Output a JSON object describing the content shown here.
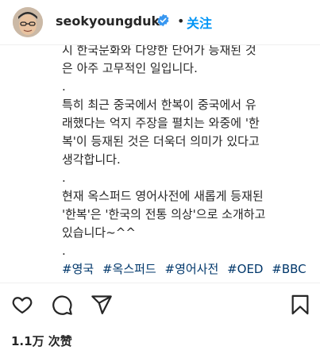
{
  "header": {
    "username": "seokyoungduk",
    "separator": "•",
    "follow_label": "关注"
  },
  "caption": {
    "lines": [
      "시 한국문화와 다양한 단어가 등재된 것",
      "은 아주 고무적인 일입니다.",
      ".",
      "특히 최근 중국에서 한복이 중국에서 유",
      "래했다는 억지 주장을 펼치는 와중에 '한",
      "복'이 등재된 것은 더욱더 의미가 있다고",
      "생각합니다.",
      ".",
      "현재 옥스퍼드 영어사전에 새롭게 등재된",
      "'한복'은 '한국의 전통 의상'으로 소개하고",
      "있습니다~^^",
      "."
    ],
    "hashtags": [
      "#영국",
      "#옥스퍼드",
      "#영어사전",
      "#OED",
      "#BBC"
    ]
  },
  "actions": {
    "icons": [
      "heart-icon",
      "comment-icon",
      "share-icon",
      "bookmark-icon"
    ]
  },
  "likes": {
    "text": "1.1万 次赞"
  },
  "colors": {
    "follow": "#0095f6",
    "hashtag": "#00376b",
    "text": "#262626",
    "verified": "#3897f0"
  }
}
